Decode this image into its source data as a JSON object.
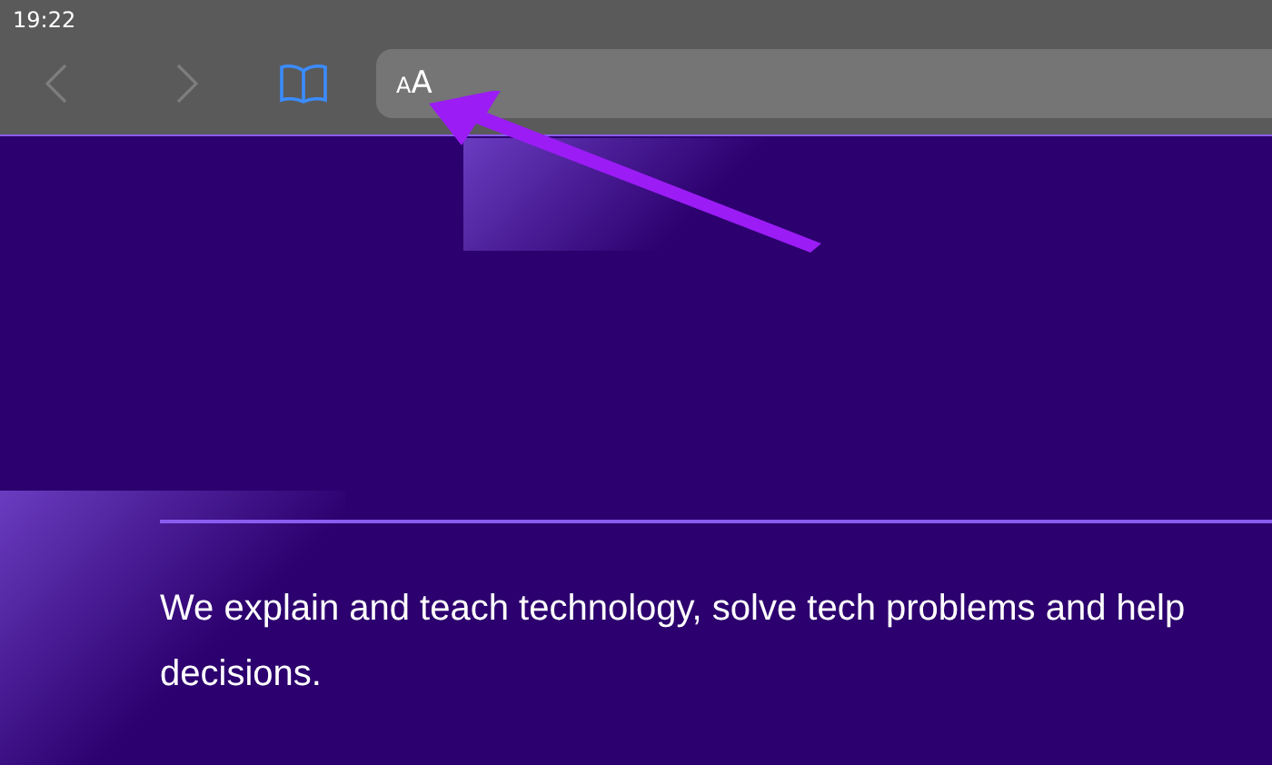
{
  "status_bar": {
    "time": "19:22"
  },
  "toolbar": {
    "nav_buttons": [
      {
        "kind": "back",
        "disabled": true
      },
      {
        "kind": "forward",
        "disabled": true
      }
    ],
    "reader_button": "AA"
  },
  "page": {
    "text_lines": [
      "We explain and teach technology, solve tech problems and help",
      "decisions."
    ]
  }
}
